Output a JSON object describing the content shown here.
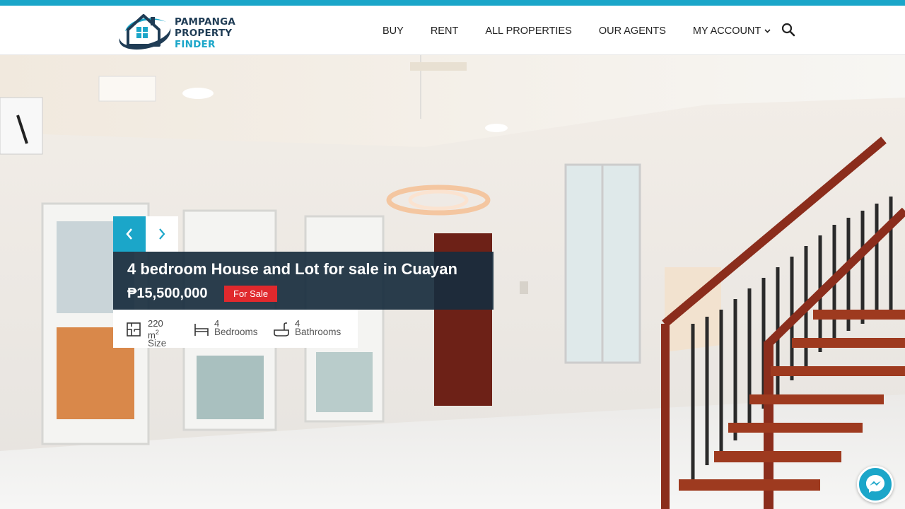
{
  "brand": {
    "line1": "PAMPANGA",
    "line2": "PROPERTY",
    "line3": "FINDER",
    "primary_color": "#1ba6c9",
    "dark_color": "#1f3c55"
  },
  "nav": {
    "items": [
      {
        "label": "BUY"
      },
      {
        "label": "RENT"
      },
      {
        "label": "ALL PROPERTIES"
      },
      {
        "label": "OUR AGENTS"
      },
      {
        "label": "MY ACCOUNT",
        "has_dropdown": true
      }
    ],
    "search_icon": "search-icon"
  },
  "hero": {
    "icon_prev": "chevron-left-icon",
    "icon_next": "chevron-right-icon"
  },
  "listing": {
    "title": "4 bedroom House and Lot for sale in Cuayan",
    "price": "₱15,500,000",
    "status": "For Sale",
    "status_color": "#e0292d",
    "specs": [
      {
        "icon": "floor-plan-icon",
        "value": "220 m",
        "sup": "2",
        "label": "Size"
      },
      {
        "icon": "bed-icon",
        "value": "4",
        "label": "Bedrooms"
      },
      {
        "icon": "bathtub-icon",
        "value": "4",
        "label": "Bathrooms"
      }
    ]
  },
  "chat": {
    "icon": "messenger-icon"
  }
}
